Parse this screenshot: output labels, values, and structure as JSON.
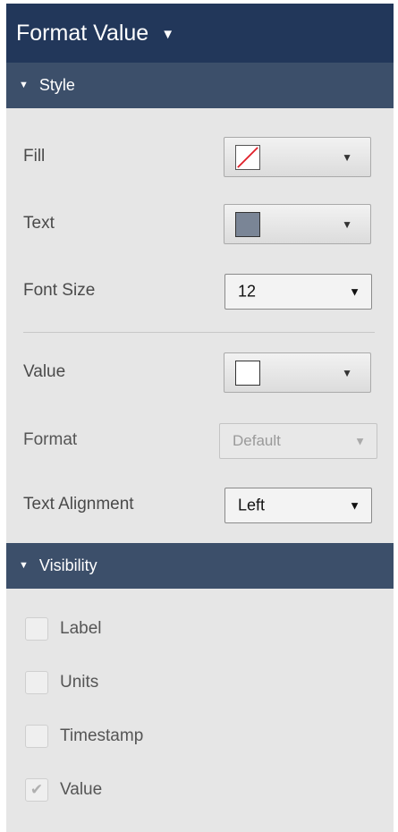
{
  "panel": {
    "title": "Format Value",
    "title_caret": "▼"
  },
  "style_section": {
    "header": "Style",
    "caret": "▼",
    "fill": {
      "label": "Fill",
      "swatch": "none-red-slash",
      "arrow": "▼"
    },
    "text": {
      "label": "Text",
      "swatch_color": "#7a8596",
      "arrow": "▼"
    },
    "font_size": {
      "label": "Font Size",
      "value": "12",
      "arrow": "▼"
    },
    "value": {
      "label": "Value",
      "swatch_color": "#ffffff",
      "arrow": "▼"
    },
    "format": {
      "label": "Format",
      "value": "Default",
      "arrow": "▼",
      "disabled": true
    },
    "text_alignment": {
      "label": "Text Alignment",
      "value": "Left",
      "arrow": "▼"
    }
  },
  "visibility_section": {
    "header": "Visibility",
    "caret": "▼",
    "items": [
      {
        "label": "Label",
        "checked": false
      },
      {
        "label": "Units",
        "checked": false
      },
      {
        "label": "Timestamp",
        "checked": false
      },
      {
        "label": "Value",
        "checked": true,
        "check_glyph": "✔"
      }
    ]
  },
  "colors": {
    "title_bar": "#22375a",
    "section_header": "#3c4f6a",
    "panel_bg": "#e6e6e6",
    "no_fill_slash": "#e0202a"
  }
}
